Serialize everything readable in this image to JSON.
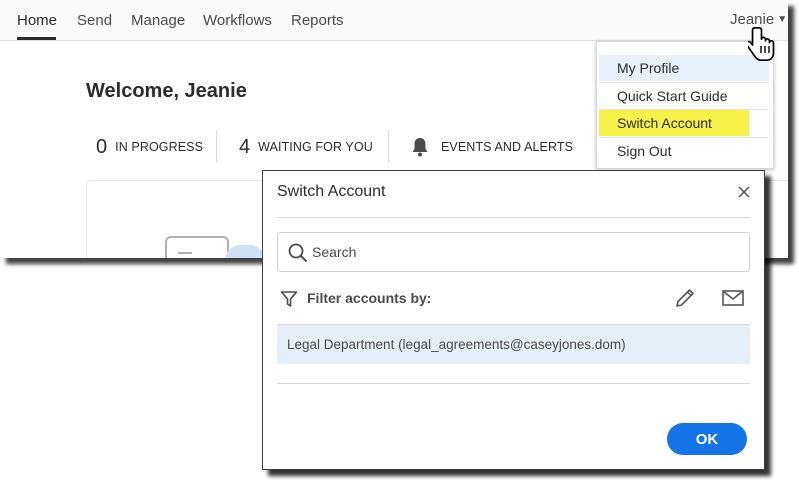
{
  "nav": {
    "items": [
      {
        "label": "Home",
        "active": true
      },
      {
        "label": "Send"
      },
      {
        "label": "Manage"
      },
      {
        "label": "Workflows"
      },
      {
        "label": "Reports"
      }
    ],
    "user": "Jeanie",
    "caret_glyph": "▼"
  },
  "home": {
    "welcome": "Welcome, Jeanie",
    "stats": {
      "in_progress": {
        "count": "0",
        "label": "IN PROGRESS"
      },
      "waiting": {
        "count": "4",
        "label": "WAITING FOR YOU"
      },
      "events": {
        "label": "EVENTS AND ALERTS",
        "icon": "bell-icon"
      }
    }
  },
  "user_menu": {
    "items": [
      {
        "label": "My Profile",
        "state": "hover"
      },
      {
        "label": "Quick Start Guide"
      },
      {
        "label": "Switch Account",
        "state": "highlighted"
      },
      {
        "label": "Sign Out"
      }
    ]
  },
  "dialog": {
    "title": "Switch Account",
    "search_placeholder": "Search",
    "filter_label": "Filter accounts by:",
    "accounts": [
      {
        "label": "Legal Department (legal_agreements@caseyjones.dom)",
        "selected": true
      }
    ],
    "ok_label": "OK"
  },
  "colors": {
    "accent": "#1473e6",
    "highlight": "#f6f24a",
    "selected_row": "#e6eef8",
    "menu_hover": "#e8f0fa"
  }
}
